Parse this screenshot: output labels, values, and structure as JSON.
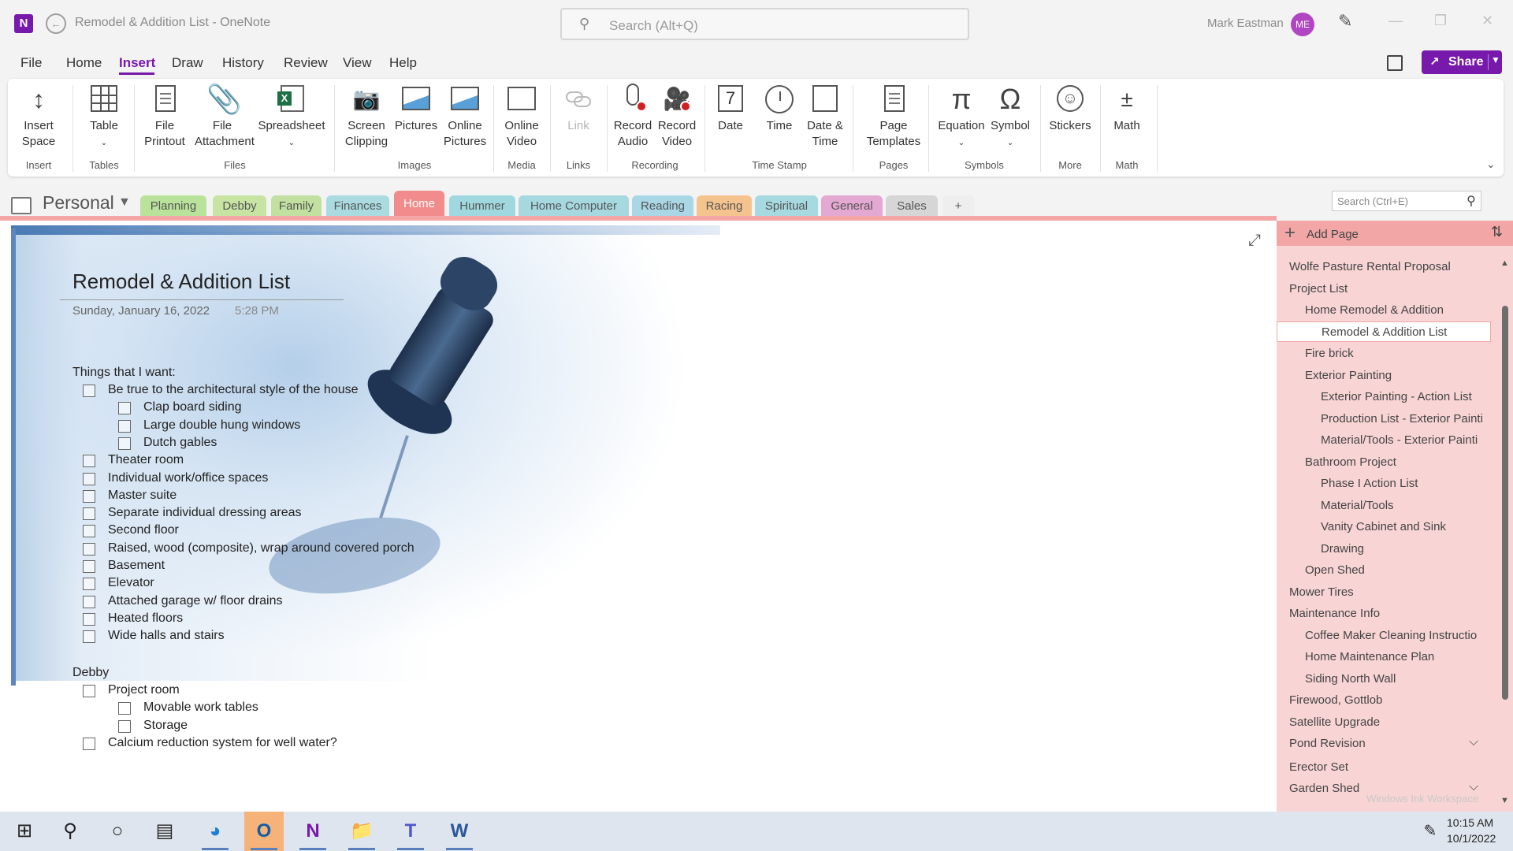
{
  "window": {
    "title": "Remodel & Addition List  -  OneNote",
    "app_logo": "N",
    "search_placeholder": "Search (Alt+Q)",
    "user_name": "Mark Eastman",
    "user_initials": "ME"
  },
  "menu": {
    "items": [
      "File",
      "Home",
      "Insert",
      "Draw",
      "History",
      "Review",
      "View",
      "Help"
    ],
    "active": "Insert",
    "share_label": "Share"
  },
  "ribbon": {
    "buttons": {
      "insert_space": "Insert Space",
      "table": "Table",
      "file_printout": "File Printout",
      "file_attachment": "File Attachment",
      "spreadsheet": "Spreadsheet",
      "screen_clipping": "Screen Clipping",
      "pictures": "Pictures",
      "online_pictures": "Online Pictures",
      "online_video": "Online Video",
      "link": "Link",
      "record_audio": "Record Audio",
      "record_video": "Record Video",
      "date": "Date",
      "time": "Time",
      "date_time": "Date & Time",
      "page_templates": "Page Templates",
      "equation": "Equation",
      "symbol": "Symbol",
      "stickers": "Stickers",
      "math": "Math"
    },
    "groups": {
      "insert": "Insert",
      "tables": "Tables",
      "files": "Files",
      "images": "Images",
      "media": "Media",
      "links": "Links",
      "recording": "Recording",
      "time_stamp": "Time Stamp",
      "pages": "Pages",
      "symbols": "Symbols",
      "more": "More",
      "math": "Math"
    },
    "calendar_day": "7"
  },
  "notebook": {
    "name": "Personal",
    "sections": [
      {
        "label": "Planning",
        "color": "#b9e29a"
      },
      {
        "label": "Debby",
        "color": "#c7e4a2"
      },
      {
        "label": "Family",
        "color": "#c2e0a0"
      },
      {
        "label": "Finances",
        "color": "#a9dbe0"
      },
      {
        "label": "Home",
        "color": "#f28c8c"
      },
      {
        "label": "Hummer",
        "color": "#9fd9df"
      },
      {
        "label": "Home Computer",
        "color": "#a6d8df"
      },
      {
        "label": "Reading",
        "color": "#a9d7e6"
      },
      {
        "label": "Racing",
        "color": "#f5c38e"
      },
      {
        "label": "Spiritual",
        "color": "#a6d9e0"
      },
      {
        "label": "General",
        "color": "#e3a9d3"
      },
      {
        "label": "Sales",
        "color": "#d6d6d6"
      },
      {
        "label": "+",
        "color": "#eeeeee"
      }
    ],
    "active_section": "Home",
    "section_search_placeholder": "Search (Ctrl+E)"
  },
  "page": {
    "title": "Remodel & Addition List",
    "date": "Sunday, January 16, 2022",
    "time": "5:28 PM",
    "heading1": "Things that I want:",
    "items1": [
      {
        "text": "Be true to the architectural style of the house",
        "level": 1
      },
      {
        "text": "Clap board siding",
        "level": 2
      },
      {
        "text": "Large double hung windows",
        "level": 2
      },
      {
        "text": "Dutch gables",
        "level": 2
      },
      {
        "text": "Theater room",
        "level": 1
      },
      {
        "text": "Individual work/office spaces",
        "level": 1
      },
      {
        "text": "Master suite",
        "level": 1
      },
      {
        "text": "Separate individual dressing areas",
        "level": 1
      },
      {
        "text": "Second floor",
        "level": 1
      },
      {
        "text": "Raised, wood (composite), wrap around covered porch",
        "level": 1
      },
      {
        "text": "Basement",
        "level": 1
      },
      {
        "text": "Elevator",
        "level": 1
      },
      {
        "text": "Attached garage w/ floor drains",
        "level": 1
      },
      {
        "text": "Heated floors",
        "level": 1
      },
      {
        "text": "Wide halls and stairs",
        "level": 1
      }
    ],
    "heading2": "Debby",
    "items2": [
      {
        "text": "Project room",
        "level": 1
      },
      {
        "text": "Movable work tables",
        "level": 2
      },
      {
        "text": "Storage",
        "level": 2
      },
      {
        "text": "Calcium reduction system for well water?",
        "level": 1
      }
    ]
  },
  "pages_panel": {
    "add_page": "Add Page",
    "pages": [
      {
        "label": "Wolfe Pasture Rental Proposal",
        "level": 1
      },
      {
        "label": "Project List",
        "level": 1
      },
      {
        "label": "Home Remodel & Addition",
        "level": 2
      },
      {
        "label": "Remodel & Addition List",
        "level": 3,
        "selected": true
      },
      {
        "label": "Fire brick",
        "level": 2
      },
      {
        "label": "Exterior Painting",
        "level": 2
      },
      {
        "label": "Exterior Painting - Action List",
        "level": 3
      },
      {
        "label": "Production List - Exterior Painti",
        "level": 3
      },
      {
        "label": "Material/Tools - Exterior Painti",
        "level": 3
      },
      {
        "label": "Bathroom Project",
        "level": 2
      },
      {
        "label": "Phase I Action List",
        "level": 3
      },
      {
        "label": "Material/Tools",
        "level": 3
      },
      {
        "label": "Vanity Cabinet and Sink",
        "level": 3
      },
      {
        "label": "Drawing",
        "level": 3
      },
      {
        "label": "Open Shed",
        "level": 2
      },
      {
        "label": "Mower Tires",
        "level": 1
      },
      {
        "label": "Maintenance Info",
        "level": 1
      },
      {
        "label": "Coffee Maker Cleaning Instructio",
        "level": 2
      },
      {
        "label": "Home Maintenance Plan",
        "level": 2
      },
      {
        "label": "Siding North Wall",
        "level": 2
      },
      {
        "label": "Firewood, Gottlob",
        "level": 1
      },
      {
        "label": "Satellite Upgrade",
        "level": 1
      },
      {
        "label": "Pond Revision",
        "level": 1,
        "collapsible": true
      },
      {
        "label": "Erector Set",
        "level": 1
      },
      {
        "label": "Garden Shed",
        "level": 1,
        "collapsible": true
      }
    ],
    "watermark": "Windows Ink Workspace"
  },
  "taskbar": {
    "time": "10:15 AM",
    "date": "10/1/2022",
    "apps": [
      "start-icon",
      "search-icon",
      "cortana-icon",
      "task-view-icon",
      "edge-icon",
      "outlook-icon",
      "onenote-icon",
      "file-explorer-icon",
      "teams-icon",
      "word-icon"
    ]
  }
}
